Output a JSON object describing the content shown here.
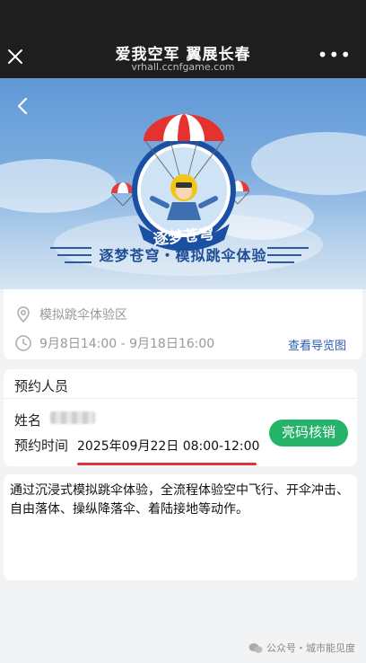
{
  "topbar": {
    "title": "爱我空军 翼展长春",
    "url": "vrhall.ccnfgame.com",
    "more": "•••"
  },
  "banner": {
    "logo_text": "逐梦苍穹",
    "slogan": "逐梦苍穹・模拟跳伞体验"
  },
  "event": {
    "location": "模拟跳伞体验区",
    "time_range": "9月8日14:00 - 9月18日16:00",
    "guide_link": "查看导览图"
  },
  "booking": {
    "header": "预约人员",
    "name_label": "姓名",
    "time_label": "预约时间",
    "time_value": "2025年09月22日 08:00-12:00",
    "verify_button": "亮码核销"
  },
  "description": "通过沉浸式模拟跳伞体验，全流程体验空中飞行、开伞冲击、自由落体、操纵降落伞、着陆接地等动作。",
  "footer": {
    "text": "公众号・城市能见度"
  },
  "colors": {
    "accent_green": "#25b36a",
    "link_blue": "#2a5bb5",
    "underline_red": "#e1323a"
  }
}
